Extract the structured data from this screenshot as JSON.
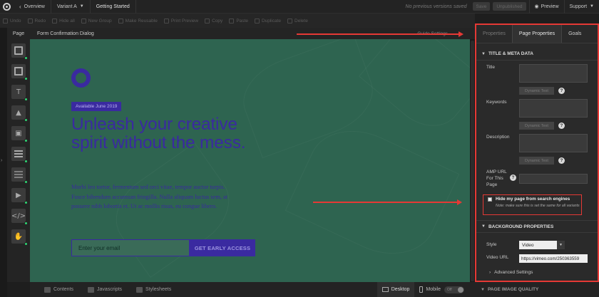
{
  "topbar": {
    "overview": "Overview",
    "variant": "Variant A",
    "page_title": "Getting Started",
    "versions": "No previous versions saved",
    "save": "Save",
    "unpublished": "Unpublished",
    "preview": "Preview",
    "support": "Support"
  },
  "toolbar": {
    "items": [
      "Undo",
      "Redo",
      "Hide all",
      "New Group",
      "Make Reusable",
      "Print Preview",
      "Copy",
      "Paste",
      "Duplicate",
      "Delete"
    ]
  },
  "left_panel": {
    "label": "Page"
  },
  "canvas_header": {
    "title": "Form Confirmation Dialog",
    "right": "Guide Settings"
  },
  "canvas": {
    "badge": "Available June 2019",
    "headline": "Unleash your creative spirit without the mess.",
    "body": "Morbi leo tortor, fermentum sed orci vitae, tempor auctor turpis. Fusce bibendum accumsan fringilla. Nulla aliquam luctus sem, at posuere nibh lobortis et. Ut ac mollis risus, eu congue libero.",
    "email_placeholder": "Enter your email",
    "cta": "GET EARLY ACCESS",
    "bg_color": "#2e6450",
    "accent": "#3a2aa0"
  },
  "bottombar": {
    "contents": "Contents",
    "javascripts": "Javascripts",
    "stylesheets": "Stylesheets",
    "desktop": "Desktop",
    "mobile": "Mobile",
    "toggle": "Off"
  },
  "right_panel": {
    "tabs": [
      "Properties",
      "Page Properties",
      "Goals"
    ],
    "section_title": "TITLE & META DATA",
    "title_label": "Title",
    "keywords_label": "Keywords",
    "description_label": "Description",
    "amp_label": "AMP URL For This Page",
    "dynamic_text": "Dynamic Text",
    "help": "?",
    "hide_label": "Hide my page from search engines",
    "hide_note": "Note: make sure this is set the same for all variants",
    "bg_section": "BACKGROUND PROPERTIES",
    "style_label": "Style",
    "style_value": "Video",
    "video_url_label": "Video URL",
    "video_url_value": "https://vimeo.com/250363559",
    "advanced": "Advanced Settings",
    "page_image_quality": "PAGE IMAGE QUALITY"
  },
  "colors": {
    "highlight": "#e53935"
  }
}
